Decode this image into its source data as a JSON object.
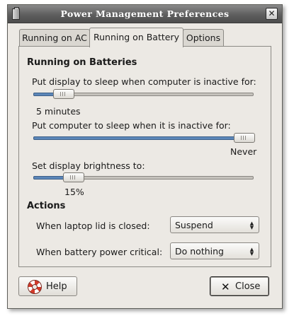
{
  "window": {
    "title": "Power Management Preferences",
    "icons": {
      "app": "battery-icon",
      "close": "close-icon"
    }
  },
  "tabs": [
    {
      "label": "Running on AC",
      "active": false
    },
    {
      "label": "Running on Battery",
      "active": true
    },
    {
      "label": "Options",
      "active": false
    }
  ],
  "battery": {
    "heading": "Running on Batteries",
    "display_sleep": {
      "label": "Put display to sleep when computer is inactive for:",
      "value": "5 minutes",
      "level": 0.1
    },
    "computer_sleep": {
      "label": "Put computer to sleep when it is inactive for:",
      "value": "Never",
      "level": 1.0
    },
    "brightness": {
      "label": "Set display brightness to:",
      "value": "15%",
      "level": 0.15
    }
  },
  "actions": {
    "heading": "Actions",
    "lid_closed": {
      "label": "When laptop lid is closed:",
      "selected": "Suspend"
    },
    "battery_critical": {
      "label": "When battery power critical:",
      "selected": "Do nothing"
    }
  },
  "buttons": {
    "help": {
      "label": "Help",
      "icon": "help-lifebuoy-icon"
    },
    "close": {
      "label": "Close",
      "icon": "close-x-icon"
    }
  },
  "colors": {
    "accent": "#5b86b8",
    "titlebar": "#5f5f5f"
  }
}
